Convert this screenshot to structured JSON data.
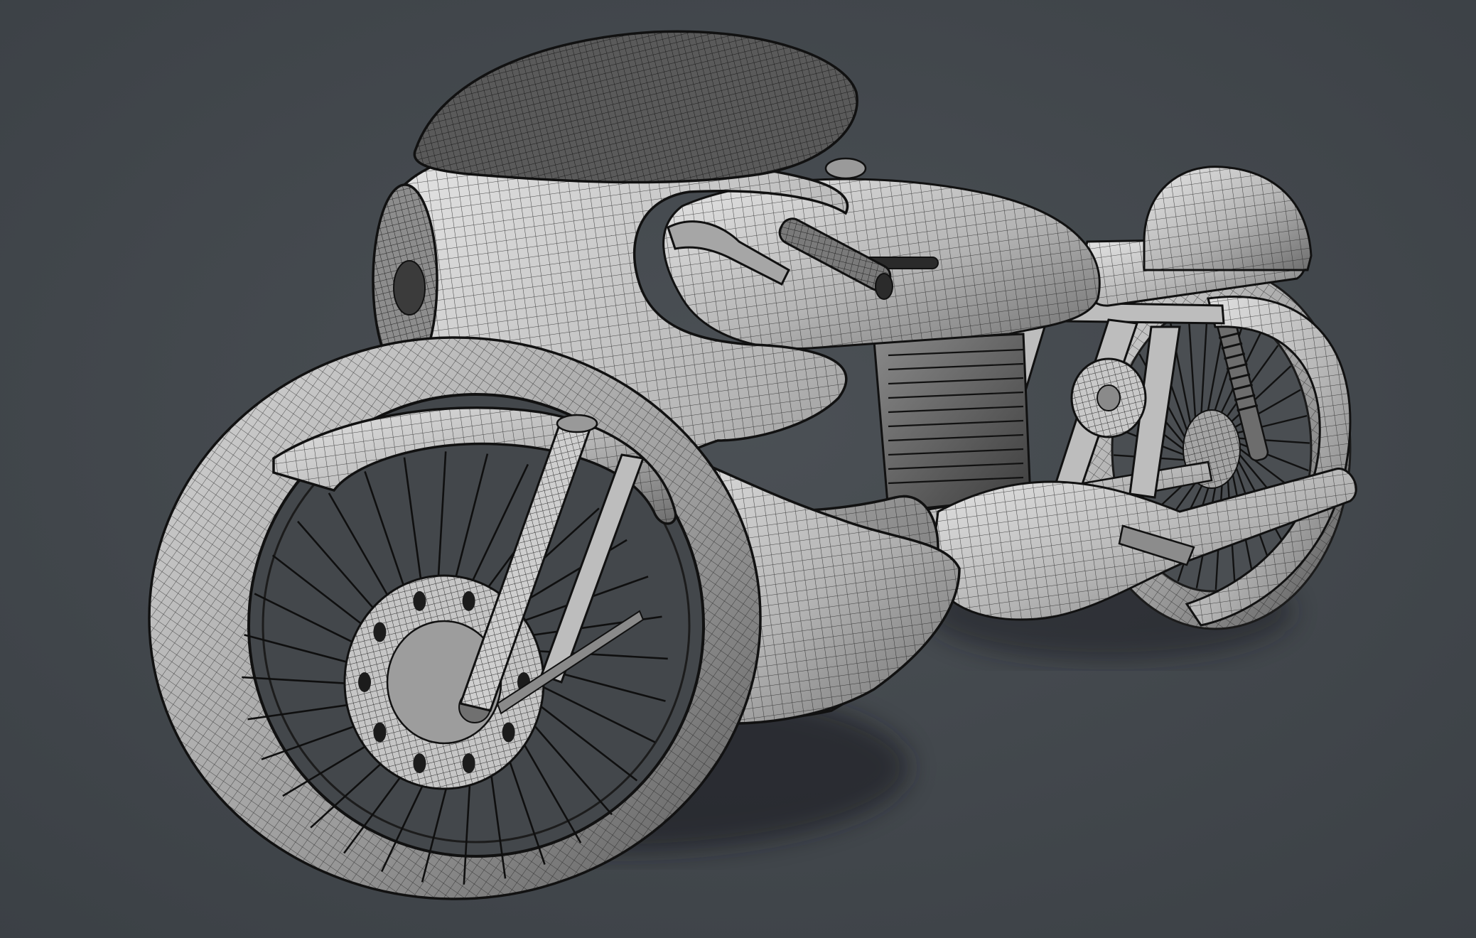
{
  "viewport": {
    "background_color": "#454a4f",
    "vignette_color": "#3a3f44",
    "render_mode": "wireframe-on-shaded",
    "subject": "cafe-racer-motorcycle-model"
  },
  "materials": {
    "body_shade_light": "#e4e4e4",
    "body_shade_mid": "#a9a9a9",
    "body_shade_dark": "#5f5f5f",
    "wire_color": "#1b1b1b",
    "shadow_color": "#15181b",
    "tire_dark": "#2b2e31"
  },
  "icons": {
    "model": "motorcycle-wireframe",
    "spokes_front": 32,
    "spokes_rear": 32
  }
}
